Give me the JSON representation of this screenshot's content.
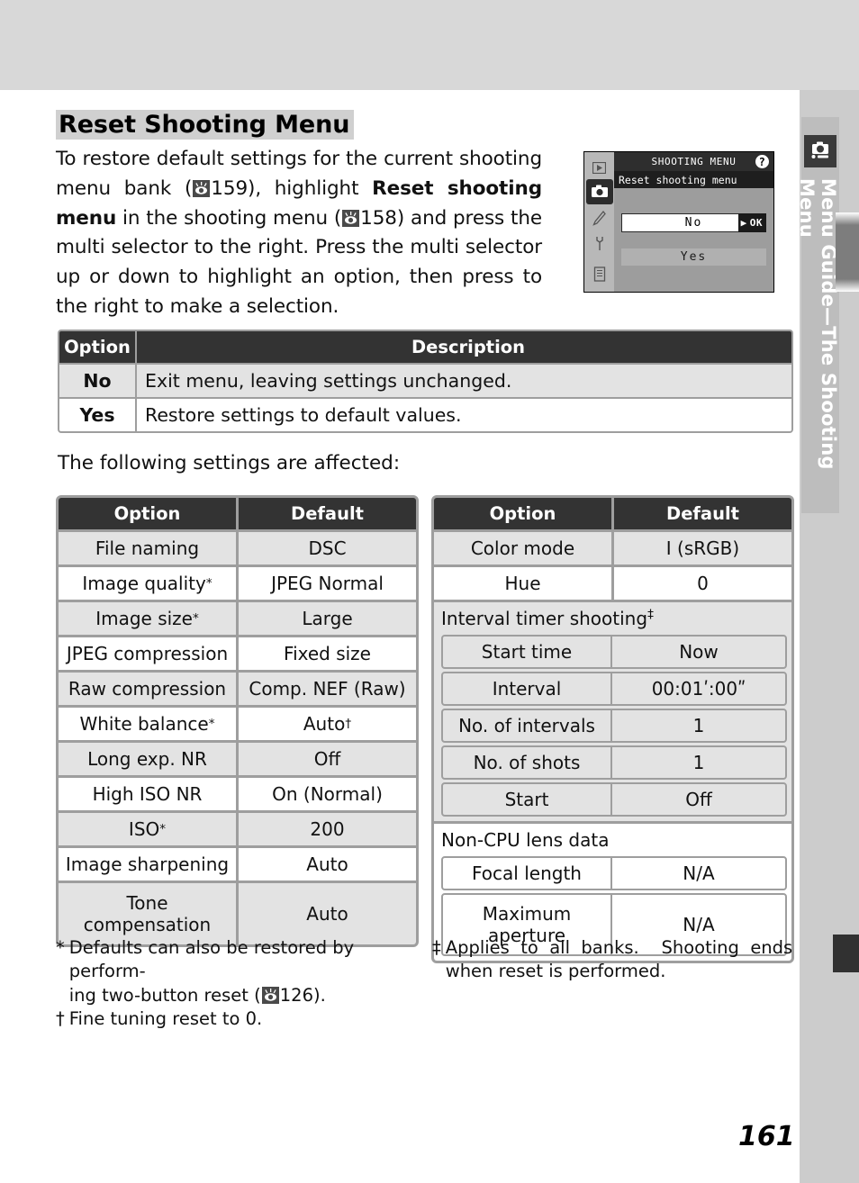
{
  "page": {
    "number": "161",
    "running_head": "Menu Guide—The Shooting Menu",
    "running_head_icon": "camera-icon"
  },
  "article": {
    "title": "Reset Shooting Menu",
    "intro_part1": "To restore default settings for the current shooting menu bank (",
    "intro_ref1": "159",
    "intro_part2": "), highlight ",
    "intro_bold1": "Reset shooting menu",
    "intro_part3": " in the shooting menu (",
    "intro_ref2": "158",
    "intro_part4": ") and press the multi selector to the right.  Press the multi selector up or down to highlight an option, then press to the right to make a selection.",
    "affected_caption": "The following settings are affected:"
  },
  "lcd": {
    "title": "SHOOTING MENU",
    "help_glyph": "?",
    "subtitle": "Reset shooting menu",
    "selected_option": "No",
    "ok_label": "OK",
    "ok_arrow": "▶",
    "other_option": "Yes",
    "sidebar_icons": [
      "playback-icon",
      "camera-icon",
      "pencil-icon",
      "wrench-icon",
      "recent-icon"
    ]
  },
  "option_table": {
    "headers": [
      "Option",
      "Description"
    ],
    "rows": [
      {
        "option": "No",
        "description": "Exit menu, leaving settings unchanged."
      },
      {
        "option": "Yes",
        "description": "Restore settings to default values."
      }
    ]
  },
  "settings_left": {
    "headers": [
      "Option",
      "Default"
    ],
    "rows": [
      {
        "option": "File naming",
        "option_sup": "",
        "default": "DSC",
        "default_sup": ""
      },
      {
        "option": "Image quality",
        "option_sup": "*",
        "default": "JPEG Normal",
        "default_sup": ""
      },
      {
        "option": "Image size",
        "option_sup": "*",
        "default": "Large",
        "default_sup": ""
      },
      {
        "option": "JPEG compression",
        "option_sup": "",
        "default": "Fixed size",
        "default_sup": ""
      },
      {
        "option": "Raw compression",
        "option_sup": "",
        "default": "Comp. NEF (Raw)",
        "default_sup": ""
      },
      {
        "option": "White balance",
        "option_sup": "*",
        "default": "Auto",
        "default_sup": "†"
      },
      {
        "option": "Long exp. NR",
        "option_sup": "",
        "default": "Off",
        "default_sup": ""
      },
      {
        "option": "High ISO NR",
        "option_sup": "",
        "default": "On (Normal)",
        "default_sup": ""
      },
      {
        "option": "ISO",
        "option_sup": "*",
        "default": "200",
        "default_sup": ""
      },
      {
        "option": "Image sharpening",
        "option_sup": "",
        "default": "Auto",
        "default_sup": ""
      },
      {
        "option": "Tone compensation",
        "option_sup": "",
        "default": "Auto",
        "default_sup": ""
      }
    ]
  },
  "settings_right": {
    "headers": [
      "Option",
      "Default"
    ],
    "rows": [
      {
        "option": "Color mode",
        "option_sup": "",
        "default": "I (sRGB)",
        "default_sup": ""
      },
      {
        "option": "Hue",
        "option_sup": "",
        "default": "0",
        "default_sup": ""
      }
    ],
    "groups": [
      {
        "title": "Interval timer shooting",
        "title_sup": "‡",
        "rows": [
          {
            "option": "Start time",
            "default": "Now"
          },
          {
            "option": "Interval",
            "default": "00:01ʹ:00ʺ"
          },
          {
            "option": "No. of intervals",
            "default": "1"
          },
          {
            "option": "No. of shots",
            "default": "1"
          },
          {
            "option": "Start",
            "default": "Off"
          }
        ]
      },
      {
        "title": "Non-CPU lens data",
        "title_sup": "",
        "rows": [
          {
            "option": "Focal length",
            "default": "N/A"
          },
          {
            "option": "Maximum aperture",
            "default": "N/A"
          }
        ]
      }
    ]
  },
  "footnotes": {
    "left": [
      {
        "mark": "*",
        "text_a": "Defaults can also be restored by perform-",
        "text_b_pre": "ing two-button reset (",
        "ref": "126",
        "text_b_post": ")."
      },
      {
        "mark": "†",
        "text_a": "Fine tuning reset to 0.",
        "text_b_pre": "",
        "ref": "",
        "text_b_post": ""
      }
    ],
    "right": [
      {
        "mark": "‡",
        "text_a": "Applies  to  all  banks.    Shooting  ends",
        "text_b_pre": "when reset is performed.",
        "ref": "",
        "text_b_post": ""
      }
    ]
  },
  "colors": {
    "header_dark": "#333333",
    "row_gray": "#e3e3e3",
    "border_gray": "#9e9e9e",
    "margin_gray": "#cccccc",
    "title_highlight": "#d0d0d0"
  }
}
